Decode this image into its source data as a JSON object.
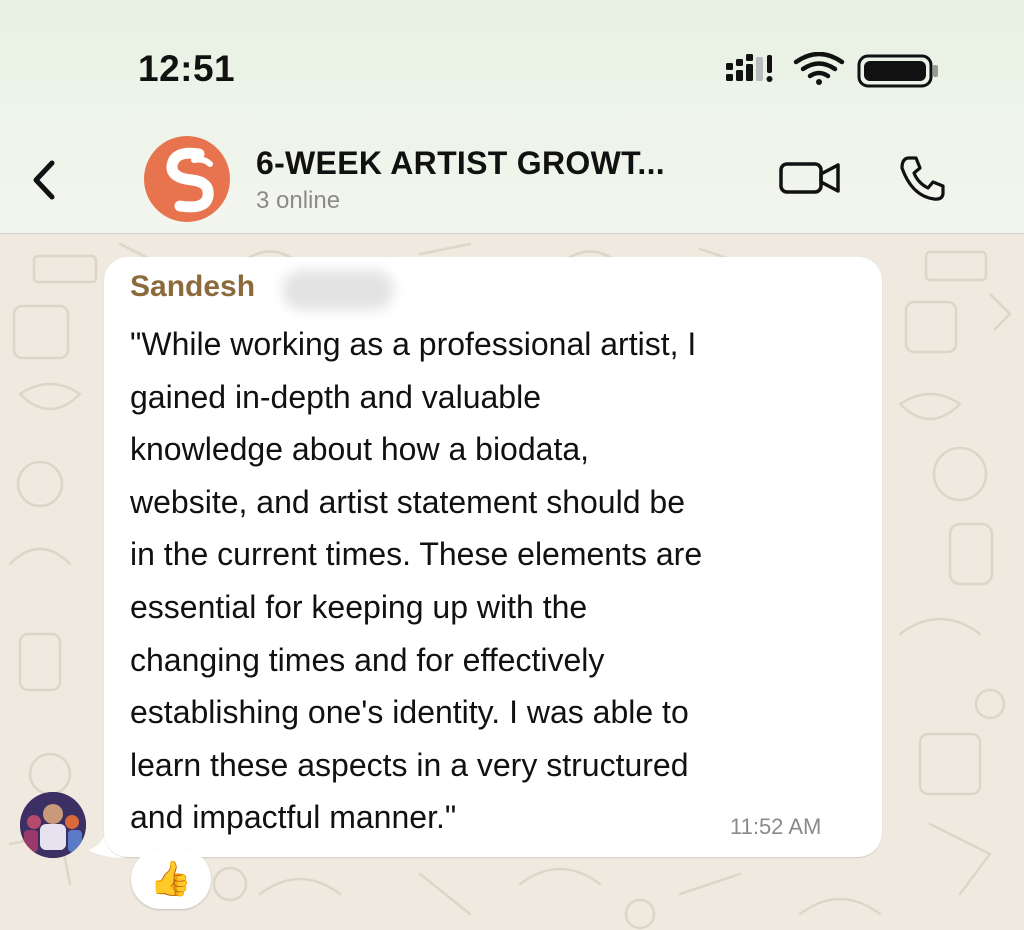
{
  "status_bar": {
    "time": "12:51"
  },
  "header": {
    "back_icon": "chevron-left-icon",
    "group_title": "6-WEEK ARTIST GROWT...",
    "subtitle": "3 online",
    "video_icon": "video-camera-icon",
    "call_icon": "phone-icon",
    "avatar_color": "#e8744f"
  },
  "message": {
    "sender": "Sandesh",
    "lines": [
      "\"While working as a professional artist, I",
      "gained in-depth and valuable",
      "knowledge about how a biodata,",
      "website, and artist statement should be",
      "in the current times. These elements are",
      "essential for keeping up with the",
      "changing times and for effectively",
      "establishing one's identity. I was able to",
      "learn these aspects in a very structured",
      "and impactful manner.\""
    ],
    "time": "11:52 AM",
    "reaction": "👍"
  },
  "colors": {
    "sender": "#8c6a3c",
    "chat_bg": "#efe9df"
  }
}
